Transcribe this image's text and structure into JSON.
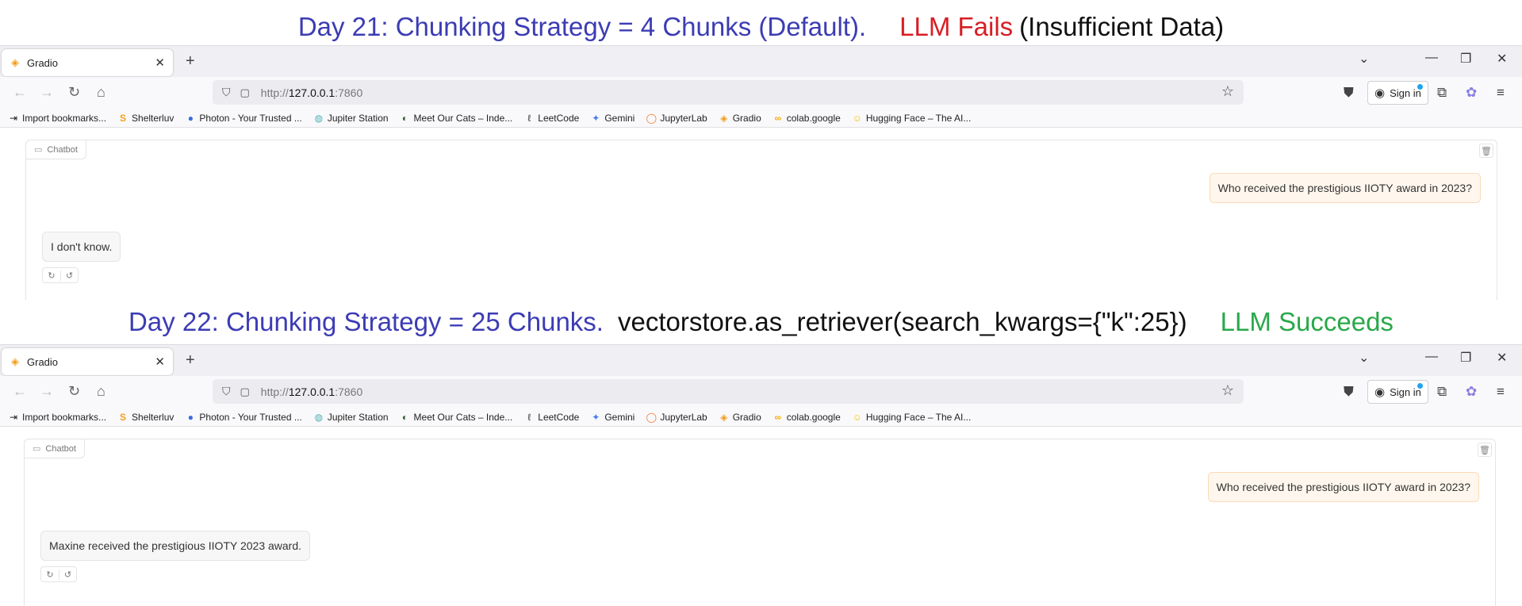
{
  "captions": {
    "top": {
      "day": "Day 21: Chunking Strategy = 4 Chunks (Default).",
      "result": "LLM Fails",
      "reason": "(Insufficient Data)"
    },
    "bottom": {
      "day": "Day 22: Chunking Strategy = 25 Chunks.",
      "code": "vectorstore.as_retriever(search_kwargs={\"k\":25})",
      "result": "LLM Succeeds"
    }
  },
  "colors": {
    "caption_blue": "#3c3cb4",
    "fail_red": "#d81e24",
    "success_green": "#2aa84a",
    "user_bubble": "#fff7ed",
    "bot_bubble": "#f7f7f8"
  },
  "browser": {
    "tab_title": "Gradio",
    "url_prefix": "http://",
    "url_host": "127.0.0.1",
    "url_port": ":7860",
    "sign_in": "Sign in",
    "bookmarks": [
      {
        "label": "Import bookmarks...",
        "icon": "import-icon"
      },
      {
        "label": "Shelterluv",
        "icon": "shelterluv-icon"
      },
      {
        "label": "Photon - Your Trusted ...",
        "icon": "photon-icon"
      },
      {
        "label": "Jupiter Station",
        "icon": "jupiter-icon"
      },
      {
        "label": "Meet Our Cats – Inde...",
        "icon": "cat-icon"
      },
      {
        "label": "LeetCode",
        "icon": "leetcode-icon"
      },
      {
        "label": "Gemini",
        "icon": "gemini-icon"
      },
      {
        "label": "JupyterLab",
        "icon": "jupyterlab-icon"
      },
      {
        "label": "Gradio",
        "icon": "gradio-icon"
      },
      {
        "label": "colab.google",
        "icon": "colab-icon"
      },
      {
        "label": "Hugging Face – The AI...",
        "icon": "huggingface-icon"
      }
    ]
  },
  "chat_top": {
    "label": "Chatbot",
    "user_message": "Who received the prestigious IIOTY award in 2023?",
    "bot_message": "I don't know."
  },
  "chat_bottom": {
    "label": "Chatbot",
    "user_message": "Who received the prestigious IIOTY award in 2023?",
    "bot_message": "Maxine received the prestigious IIOTY 2023 award."
  }
}
